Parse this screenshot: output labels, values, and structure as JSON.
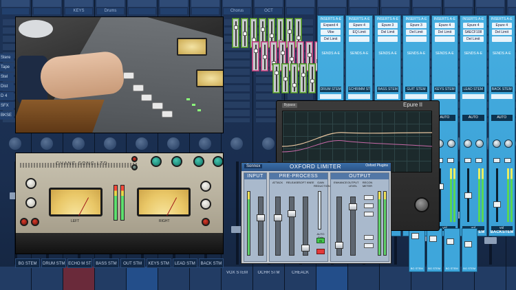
{
  "background_mixer": {
    "strip_names": [
      "",
      "",
      "KEYS",
      "Drums",
      "",
      "",
      "",
      "Chorus",
      "OCT",
      "",
      "",
      "",
      "",
      "",
      "",
      "",
      ""
    ],
    "bottom_labels": [
      "",
      "",
      "",
      "",
      "",
      "",
      "",
      "VOX STEM",
      "OCHR STM",
      "CHEACK",
      "",
      "",
      "",
      "",
      "",
      "",
      ""
    ]
  },
  "left_labels": [
    "Stere",
    "Tape",
    "Stel",
    "Dist",
    "D 4",
    "SFX",
    "BKSE"
  ],
  "strip_label_bar": [
    "BG STEM",
    "DRUM STM",
    "ECHO M STM",
    "BASS STM",
    "OUT STM",
    "KEYS STM",
    "LEAD STM",
    "BACK STM"
  ],
  "plugins": {
    "epure": {
      "title": "Epure II",
      "bypass": "Bypass"
    },
    "oxford": {
      "logo": "Sonnox",
      "name": "OXFORD LIMITER",
      "brand": "Oxford Plugins",
      "input_title": "INPUT",
      "preprocess_title": "PRE-PROCESS",
      "output_title": "OUTPUT",
      "params": [
        "ATTACK",
        "RELEASE",
        "SOFT KNEE",
        "GAIN REDUCTION",
        "ENHANCE",
        "OUTPUT LEVEL",
        "RECON METER"
      ],
      "auto_gain": "AUTO Gain",
      "in_label": "IN"
    }
  },
  "compressor": {
    "brand": "CHANE SONG LTD",
    "left_label": "LEFT",
    "right_label": "RIGHT"
  },
  "pt_mixer": {
    "strips": [
      {
        "insert": "INSERTS A-E",
        "slots": [
          "Expand 4",
          "Vibe",
          "Del Limit"
        ],
        "io": "DRUM STEM",
        "name": ""
      },
      {
        "insert": "INSERTS A-E",
        "slots": [
          "Epure 4",
          "EQ Limit",
          ""
        ],
        "io": "SCHRIMM STEM",
        "name": ""
      },
      {
        "insert": "INSERTS A-E",
        "slots": [
          "Epure 3",
          "Del Limit",
          ""
        ],
        "io": "BASS STEM",
        "name": ""
      },
      {
        "insert": "INSERTS A-E",
        "slots": [
          "Epure 3",
          "Del Limit",
          ""
        ],
        "io": "GUIT STEM",
        "name": ""
      },
      {
        "insert": "INSERTS A-E",
        "slots": [
          "Epure 4",
          "Del Limit",
          ""
        ],
        "io": "KEYS STEM",
        "name": ""
      },
      {
        "insert": "INSERTS A-E",
        "slots": [
          "Epure 4",
          "SAECF108",
          "Del Limit"
        ],
        "io": "LEAD STEM",
        "name": "LEADSTEM"
      },
      {
        "insert": "INSERTS A-E",
        "slots": [
          "Epure 4",
          "Del Limit",
          ""
        ],
        "io": "BACK STEM",
        "name": "BACKSTEM"
      }
    ],
    "sends_label": "SENDS A-E",
    "auto_label": "AUTO",
    "vol_label": "vol",
    "stubs": [
      "BG STEM",
      "BG STEM",
      "BG STEM",
      "BG STEM"
    ]
  }
}
